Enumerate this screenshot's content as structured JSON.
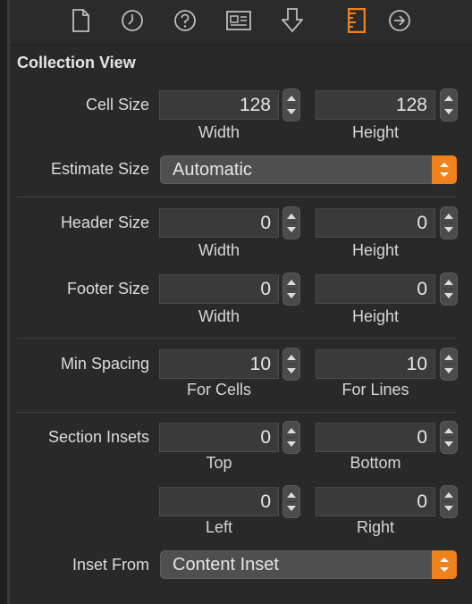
{
  "toolbar": {
    "icons": [
      "file-inspector-icon",
      "history-inspector-icon",
      "quick-help-icon",
      "identity-inspector-icon",
      "attributes-inspector-icon",
      "size-inspector-icon",
      "connections-inspector-icon"
    ],
    "active_color": "#f0821e"
  },
  "section": {
    "title": "Collection View"
  },
  "cell_size": {
    "label": "Cell Size",
    "width": "128",
    "height": "128",
    "width_label": "Width",
    "height_label": "Height"
  },
  "estimate_size": {
    "label": "Estimate Size",
    "value": "Automatic"
  },
  "header_size": {
    "label": "Header Size",
    "width": "0",
    "height": "0",
    "width_label": "Width",
    "height_label": "Height"
  },
  "footer_size": {
    "label": "Footer Size",
    "width": "0",
    "height": "0",
    "width_label": "Width",
    "height_label": "Height"
  },
  "min_spacing": {
    "label": "Min Spacing",
    "cells": "10",
    "lines": "10",
    "cells_label": "For Cells",
    "lines_label": "For Lines"
  },
  "section_insets": {
    "label": "Section Insets",
    "top": "0",
    "bottom": "0",
    "left": "0",
    "right": "0",
    "top_label": "Top",
    "bottom_label": "Bottom",
    "left_label": "Left",
    "right_label": "Right"
  },
  "inset_from": {
    "label": "Inset From",
    "value": "Content Inset"
  }
}
